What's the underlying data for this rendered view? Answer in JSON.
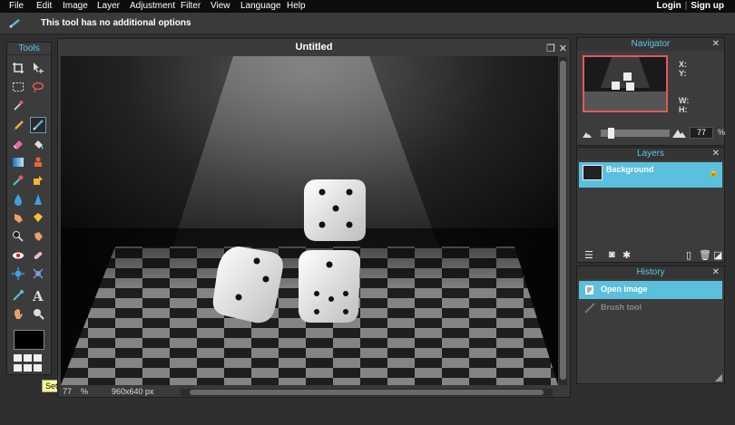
{
  "menu": {
    "items": [
      "File",
      "Edit",
      "Image",
      "Layer",
      "Adjustment",
      "Filter",
      "View",
      "Language",
      "Help"
    ],
    "login": "Login",
    "separator": "|",
    "signup": "Sign up"
  },
  "options": {
    "message": "This tool has no additional options"
  },
  "tools": {
    "title": "Tools",
    "tooltip": "Set main color",
    "icons": [
      "crop-icon",
      "move-icon",
      "marquee-select-icon",
      "lasso-icon",
      "magic-wand-icon",
      "pencil-icon",
      "brush-icon",
      "eraser-icon",
      "paint-bucket-icon",
      "gradient-icon",
      "clone-stamp-icon",
      "color-replace-icon",
      "draw-icon",
      "blur-icon",
      "sharpen-icon",
      "smudge-icon",
      "sponge-icon",
      "dodge-icon",
      "burn-icon",
      "red-eye-icon",
      "spot-heal-icon",
      "bloat-icon",
      "pinch-icon",
      "color-picker-icon",
      "type-icon",
      "hand-icon",
      "zoom-icon"
    ]
  },
  "document": {
    "title": "Untitled",
    "zoom_value": "77",
    "zoom_unit": "%",
    "dimensions": "960x640 px"
  },
  "navigator": {
    "title": "Navigator",
    "x_label": "X:",
    "y_label": "Y:",
    "w_label": "W:",
    "h_label": "H:",
    "zoom_value": "77",
    "zoom_unit": "%"
  },
  "layers": {
    "title": "Layers",
    "items": [
      {
        "name": "Background",
        "locked": true
      }
    ]
  },
  "history": {
    "title": "History",
    "items": [
      {
        "label": "Open image",
        "active": true
      },
      {
        "label": "Brush tool",
        "active": false
      }
    ]
  },
  "colors": {
    "accent": "#5bbfde",
    "title_accent": "#5bc5e6",
    "nav_frame": "#e05a5a"
  }
}
